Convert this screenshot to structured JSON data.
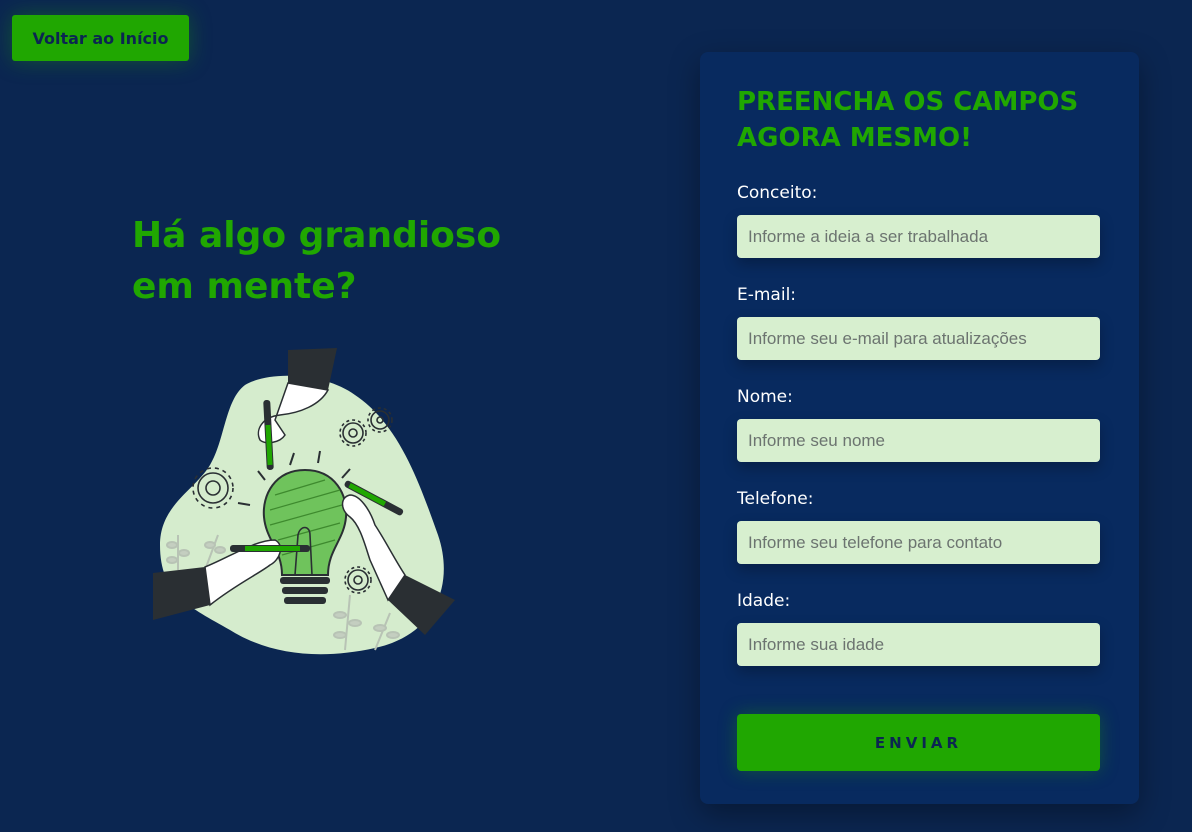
{
  "nav": {
    "back_label": "Voltar ao Início"
  },
  "hero": {
    "title": "Há algo grandioso em mente?",
    "illustration_icon": "lightbulb-idea-illustration"
  },
  "form": {
    "heading": "PREENCHA OS CAMPOS AGORA MESMO!",
    "fields": [
      {
        "label": "Conceito:",
        "placeholder": "Informe a ideia a ser trabalhada",
        "value": ""
      },
      {
        "label": "E-mail:",
        "placeholder": "Informe seu e-mail para atualizações",
        "value": ""
      },
      {
        "label": "Nome:",
        "placeholder": "Informe seu nome",
        "value": ""
      },
      {
        "label": "Telefone:",
        "placeholder": "Informe seu telefone para contato",
        "value": ""
      },
      {
        "label": "Idade:",
        "placeholder": "Informe sua idade",
        "value": ""
      }
    ],
    "submit_label": "ENVIAR"
  },
  "colors": {
    "background": "#0b2651",
    "card": "#082a5f",
    "accent_green": "#20a701",
    "input_bg": "#d7efcf",
    "text_white": "#ffffff"
  }
}
